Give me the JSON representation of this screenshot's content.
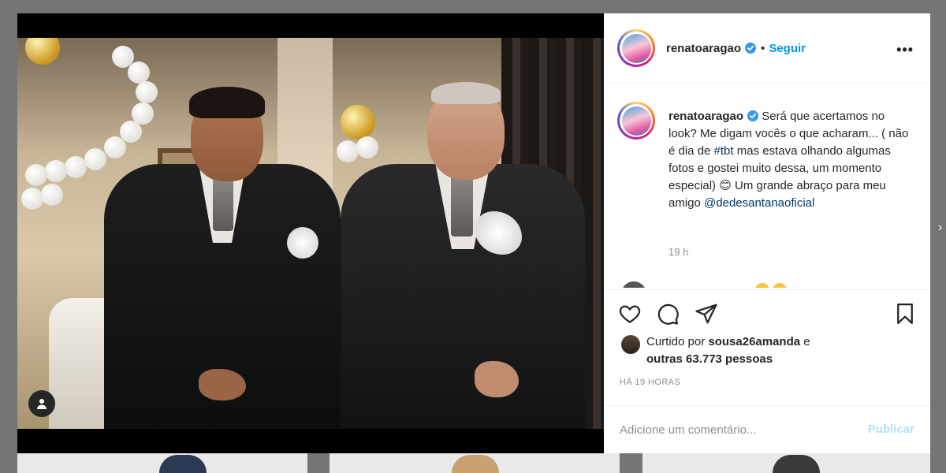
{
  "header": {
    "username": "renatoaragao",
    "dot": "•",
    "follow_label": "Seguir",
    "more_label": "•••"
  },
  "caption": {
    "username": "renatoaragao",
    "text_line": "Será que acertamos no look? Me digam vocês o que acharam... ( não é dia de ",
    "hashtag": "#tbt",
    "text_after_hashtag": " mas estava olhando algumas fotos e gostei muito dessa, um momento especial) 😊 Um grande abraço para meu amigo ",
    "mention": "@dedesantanaoficial",
    "relative_time": "19 h"
  },
  "likes": {
    "prefix": "Curtido por ",
    "liked_by": "sousa26amanda",
    "connector": " e",
    "others": "outras 63.773 pessoas"
  },
  "timestamp": "HÁ 19 HORAS",
  "comment": {
    "placeholder": "Adicione um comentário...",
    "publish_label": "Publicar"
  },
  "icons": {
    "verified": "verified-badge-icon",
    "like": "heart-icon",
    "comment": "comment-bubble-icon",
    "share": "paper-plane-icon",
    "save": "bookmark-icon",
    "user_tag": "user-tag-icon",
    "more": "more-options-icon"
  },
  "colors": {
    "accent": "#0095f6",
    "publish_disabled": "#b2dffc",
    "verified": "#3897f0",
    "secondary_text": "#8e8e8e"
  }
}
